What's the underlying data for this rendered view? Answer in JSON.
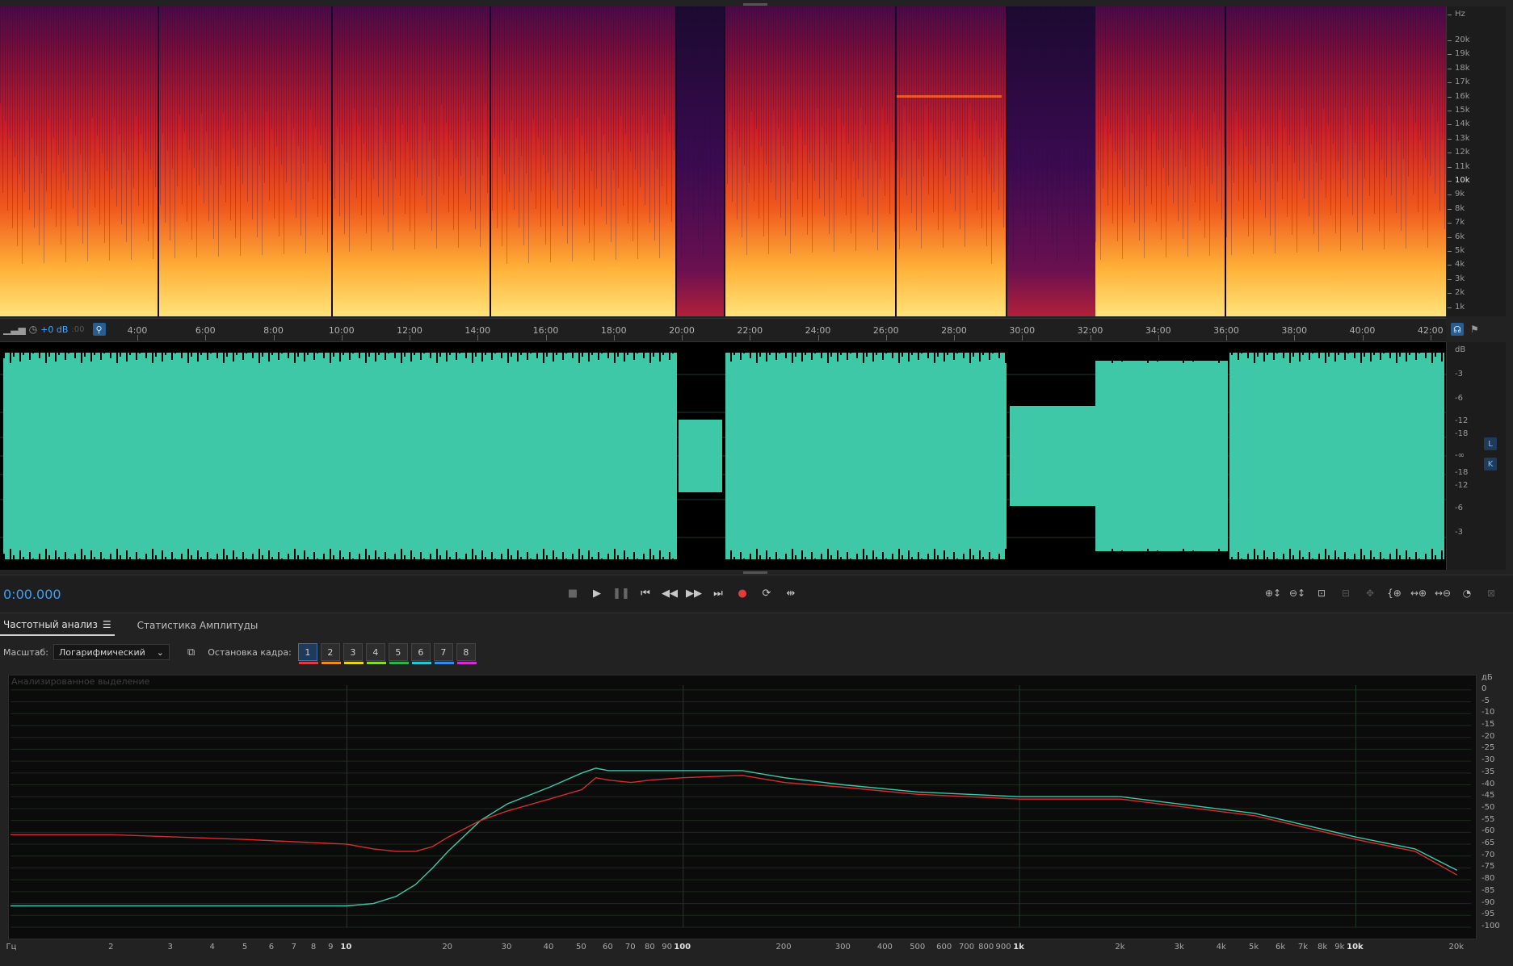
{
  "spectrogram": {
    "unit_label": "Hz",
    "freq_ticks": [
      "20k",
      "19k",
      "18k",
      "17k",
      "16k",
      "15k",
      "14k",
      "13k",
      "12k",
      "11k",
      "10k",
      "9k",
      "8k",
      "7k",
      "6k",
      "5k",
      "4k",
      "3k",
      "2k",
      "1k"
    ]
  },
  "timeline": {
    "gain_label": "+0 dB",
    "partial_label": ":00",
    "ticks": [
      "4:00",
      "6:00",
      "8:00",
      "10:00",
      "12:00",
      "14:00",
      "16:00",
      "18:00",
      "20:00",
      "22:00",
      "24:00",
      "26:00",
      "28:00",
      "30:00",
      "32:00",
      "34:00",
      "36:00",
      "38:00",
      "40:00",
      "42:00"
    ]
  },
  "waveform": {
    "unit_label": "dB",
    "db_ticks_top": [
      "-3",
      "-6",
      "-12",
      "-18"
    ],
    "center_label": "-∞",
    "db_ticks_bottom": [
      "-18",
      "-12",
      "-6",
      "-3"
    ],
    "channel_top": "L",
    "channel_bottom": "K",
    "colors": {
      "wave": "#3ec8a8",
      "background": "#000000"
    }
  },
  "transport": {
    "current_time": "0:00.000",
    "buttons": [
      "stop-icon",
      "play-icon",
      "pause-icon",
      "skip-start-icon",
      "rewind-icon",
      "fast-forward-icon",
      "skip-end-icon",
      "record-icon",
      "loop-icon",
      "skip-silence-icon"
    ]
  },
  "zoom_buttons": [
    "zoom-in-amplitude-icon",
    "zoom-out-amplitude-icon",
    "zoom-selection-icon",
    "zoom-full-icon",
    "zoom-reset-icon",
    "zoom-in-left-icon",
    "zoom-in-time-icon",
    "zoom-out-time-icon",
    "zoom-to-session-icon",
    "zoom-out-full-icon"
  ],
  "analysis": {
    "tabs": [
      {
        "label": "Частотный анализ",
        "active": true
      },
      {
        "label": "Статистика Амплитуды",
        "active": false
      }
    ],
    "scale_label": "Масштаб:",
    "scale_value": "Логарифмический",
    "freeze_label": "Остановка кадра:",
    "frames": [
      {
        "label": "1",
        "color": "#e23b3b"
      },
      {
        "label": "2",
        "color": "#f08a1e"
      },
      {
        "label": "3",
        "color": "#e8d51e"
      },
      {
        "label": "4",
        "color": "#8bd82a"
      },
      {
        "label": "5",
        "color": "#23b84a"
      },
      {
        "label": "6",
        "color": "#22c8d8"
      },
      {
        "label": "7",
        "color": "#2a8ef0"
      },
      {
        "label": "8",
        "color": "#d62ad6"
      }
    ],
    "chart_caption": "Анализированное выделение",
    "db_unit": "дБ",
    "db_ticks": [
      "0",
      "-5",
      "-10",
      "-15",
      "-20",
      "-25",
      "-30",
      "-35",
      "-40",
      "-45",
      "-50",
      "-55",
      "-60",
      "-65",
      "-70",
      "-75",
      "-80",
      "-85",
      "-90",
      "-95",
      "-100"
    ],
    "freq_unit": "Гц",
    "freq_ticks": [
      "2",
      "3",
      "4",
      "5",
      "6",
      "7",
      "8",
      "9",
      "10",
      "20",
      "30",
      "40",
      "50",
      "60",
      "70",
      "80",
      "90",
      "100",
      "200",
      "300",
      "400",
      "500",
      "600",
      "700",
      "800",
      "900",
      "1k",
      "2k",
      "3k",
      "4k",
      "5k",
      "6k",
      "7k",
      "8k",
      "9k",
      "10k",
      "20k"
    ]
  },
  "chart_data": {
    "type": "line",
    "x_scale": "log",
    "xlim": [
      1,
      22000
    ],
    "ylim": [
      -100,
      2
    ],
    "xlabel": "Гц",
    "ylabel": "дБ",
    "grid": true,
    "series": [
      {
        "color": "#3ec8a8",
        "x": [
          1,
          2,
          5,
          10,
          12,
          14,
          16,
          18,
          20,
          25,
          30,
          40,
          50,
          55,
          60,
          70,
          80,
          100,
          150,
          200,
          300,
          500,
          1000,
          2000,
          5000,
          10000,
          15000,
          20000
        ],
        "y": [
          -91,
          -91,
          -91,
          -91,
          -90,
          -87,
          -82,
          -75,
          -68,
          -55,
          -48,
          -41,
          -35,
          -33,
          -34,
          -34,
          -34,
          -34,
          -34,
          -37,
          -40,
          -43,
          -45,
          -45,
          -52,
          -62,
          -67,
          -76
        ]
      },
      {
        "color": "#d32f2f",
        "x": [
          1,
          2,
          5,
          10,
          12,
          14,
          16,
          18,
          20,
          25,
          30,
          40,
          50,
          55,
          60,
          70,
          80,
          100,
          150,
          200,
          300,
          500,
          1000,
          2000,
          5000,
          10000,
          15000,
          20000
        ],
        "y": [
          -61,
          -61,
          -63,
          -65,
          -67,
          -68,
          -68,
          -66,
          -62,
          -55,
          -51,
          -46,
          -42,
          -37,
          -38,
          -39,
          -38,
          -37,
          -36,
          -39,
          -41,
          -44,
          -46,
          -46,
          -53,
          -63,
          -68,
          -78
        ]
      }
    ]
  }
}
